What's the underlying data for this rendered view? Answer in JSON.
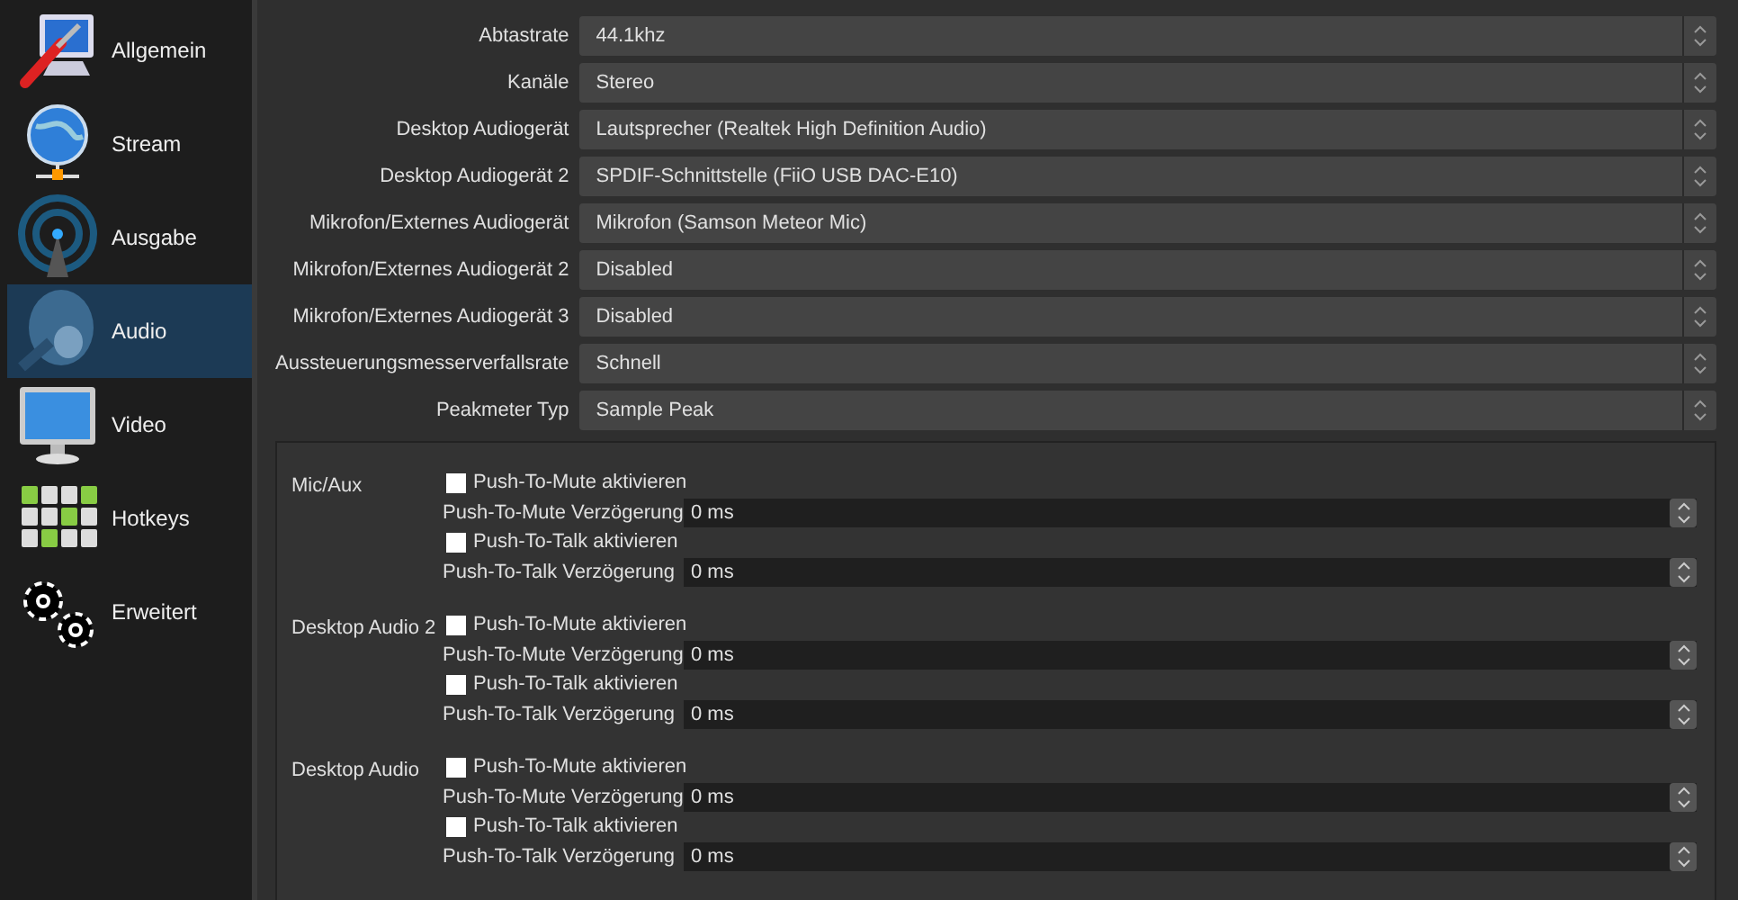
{
  "sidebar": {
    "items": [
      {
        "label": "Allgemein",
        "kind": "general",
        "selected": false
      },
      {
        "label": "Stream",
        "kind": "stream",
        "selected": false
      },
      {
        "label": "Ausgabe",
        "kind": "output",
        "selected": false
      },
      {
        "label": "Audio",
        "kind": "audio",
        "selected": true
      },
      {
        "label": "Video",
        "kind": "video",
        "selected": false
      },
      {
        "label": "Hotkeys",
        "kind": "hotkeys",
        "selected": false
      },
      {
        "label": "Erweitert",
        "kind": "advanced",
        "selected": false
      }
    ]
  },
  "settings": [
    {
      "label": "Abtastrate",
      "value": "44.1khz"
    },
    {
      "label": "Kanäle",
      "value": "Stereo"
    },
    {
      "label": "Desktop Audiogerät",
      "value": "Lautsprecher (Realtek High Definition Audio)"
    },
    {
      "label": "Desktop Audiogerät 2",
      "value": "SPDIF-Schnittstelle (FiiO USB DAC-E10)"
    },
    {
      "label": "Mikrofon/Externes Audiogerät",
      "value": "Mikrofon (Samson Meteor Mic)"
    },
    {
      "label": "Mikrofon/Externes Audiogerät 2",
      "value": "Disabled"
    },
    {
      "label": "Mikrofon/Externes Audiogerät 3",
      "value": "Disabled"
    },
    {
      "label": "Aussteuerungsmesserverfallsrate",
      "value": "Schnell"
    },
    {
      "label": "Peakmeter Typ",
      "value": "Sample Peak"
    }
  ],
  "hotkey_groups": [
    {
      "name": "Mic/Aux",
      "fields": [
        {
          "kind": "checkbox",
          "label": "Push-To-Mute aktivieren",
          "checked": false
        },
        {
          "kind": "spin",
          "label": "Push-To-Mute Verzögerung",
          "value": "0 ms"
        },
        {
          "kind": "checkbox",
          "label": "Push-To-Talk aktivieren",
          "checked": false
        },
        {
          "kind": "spin",
          "label": "Push-To-Talk Verzögerung",
          "value": "0 ms"
        }
      ]
    },
    {
      "name": "Desktop Audio 2",
      "fields": [
        {
          "kind": "checkbox",
          "label": "Push-To-Mute aktivieren",
          "checked": false
        },
        {
          "kind": "spin",
          "label": "Push-To-Mute Verzögerung",
          "value": "0 ms"
        },
        {
          "kind": "checkbox",
          "label": "Push-To-Talk aktivieren",
          "checked": false
        },
        {
          "kind": "spin",
          "label": "Push-To-Talk Verzögerung",
          "value": "0 ms"
        }
      ]
    },
    {
      "name": "Desktop Audio",
      "fields": [
        {
          "kind": "checkbox",
          "label": "Push-To-Mute aktivieren",
          "checked": false
        },
        {
          "kind": "spin",
          "label": "Push-To-Mute Verzögerung",
          "value": "0 ms"
        },
        {
          "kind": "checkbox",
          "label": "Push-To-Talk aktivieren",
          "checked": false
        },
        {
          "kind": "spin",
          "label": "Push-To-Talk Verzögerung",
          "value": "0 ms"
        }
      ]
    }
  ]
}
